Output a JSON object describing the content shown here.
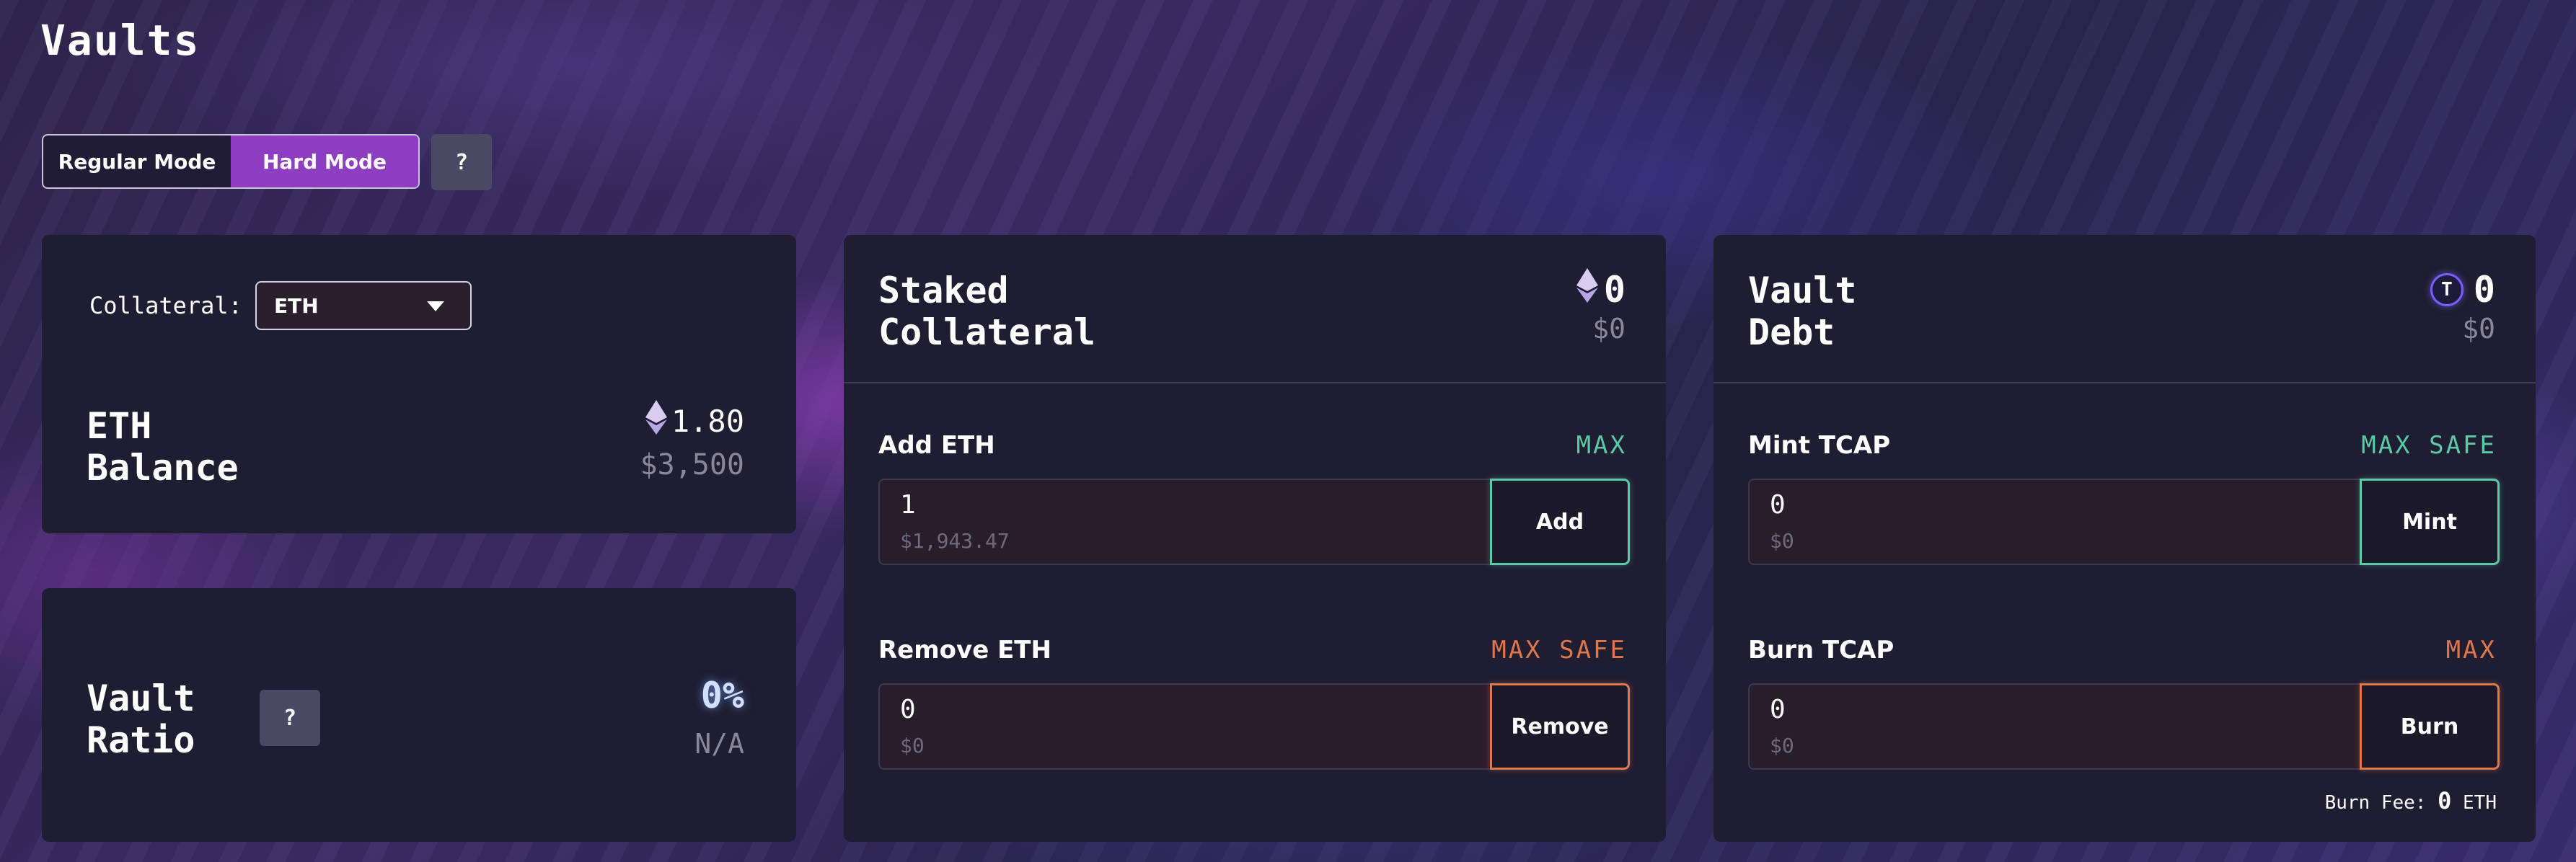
{
  "page": {
    "title": "Vaults"
  },
  "mode_toggle": {
    "regular": "Regular Mode",
    "hard": "Hard Mode",
    "active": "hard",
    "help": "?"
  },
  "balance_card": {
    "collateral_label": "Collateral:",
    "collateral_selected": "ETH",
    "title_line1": "ETH",
    "title_line2": "Balance",
    "amount": "1.80",
    "usd": "$3,500"
  },
  "ratio_card": {
    "title_line1": "Vault",
    "title_line2": "Ratio",
    "help": "?",
    "value": "0%",
    "sub": "N/A"
  },
  "staked_card": {
    "title_line1": "Staked",
    "title_line2": "Collateral",
    "amount": "0",
    "usd": "$0",
    "add": {
      "label": "Add ETH",
      "max": "MAX",
      "value": "1",
      "usd": "$1,943.47",
      "button": "Add"
    },
    "remove": {
      "label": "Remove ETH",
      "max": "MAX SAFE",
      "value": "0",
      "usd": "$0",
      "button": "Remove"
    }
  },
  "debt_card": {
    "title_line1": "Vault",
    "title_line2": "Debt",
    "token_icon_letter": "T",
    "amount": "0",
    "usd": "$0",
    "mint": {
      "label": "Mint TCAP",
      "max": "MAX SAFE",
      "value": "0",
      "usd": "$0",
      "button": "Mint"
    },
    "burn": {
      "label": "Burn TCAP",
      "max": "MAX",
      "value": "0",
      "usd": "$0",
      "button": "Burn"
    },
    "burn_fee": {
      "label": "Burn Fee:",
      "value": "0",
      "unit": "ETH"
    }
  },
  "colors": {
    "accent_purple": "#8e3ec0",
    "teal": "#5cc9a7",
    "orange": "#e0774a",
    "card_bg": "#1f1d31"
  },
  "icons": {
    "eth": "ethereum-icon",
    "tcap": "tcap-token-icon",
    "dropdown": "chevron-down-icon"
  }
}
